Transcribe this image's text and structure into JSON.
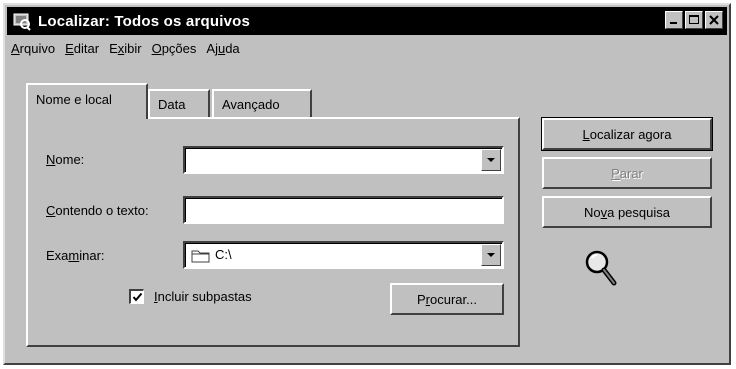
{
  "window": {
    "title": "Localizar: Todos os arquivos",
    "icon": "find-window-icon"
  },
  "menu": [
    {
      "pre": "",
      "u": "A",
      "post": "rquivo"
    },
    {
      "pre": "",
      "u": "E",
      "post": "ditar"
    },
    {
      "pre": "E",
      "u": "x",
      "post": "ibir"
    },
    {
      "pre": "",
      "u": "O",
      "post": "pções"
    },
    {
      "pre": "Aj",
      "u": "u",
      "post": "da"
    }
  ],
  "tabs": [
    {
      "label": "Nome e local",
      "active": true
    },
    {
      "label": "Data",
      "active": false
    },
    {
      "label": "Avançado",
      "active": false
    }
  ],
  "form": {
    "nome": {
      "pre": "",
      "u": "N",
      "post": "ome:",
      "value": ""
    },
    "contendo": {
      "pre": "",
      "u": "C",
      "post": "ontendo o texto:",
      "value": ""
    },
    "examinar": {
      "pre": "Exa",
      "u": "m",
      "post": "inar:",
      "value": "C:\\",
      "icon": "folder-icon"
    },
    "incluir": {
      "pre": "",
      "u": "I",
      "post": "ncluir subpastas",
      "checked": true
    },
    "procurar": {
      "pre": "P",
      "u": "r",
      "post": "ocurar..."
    }
  },
  "buttons": {
    "localizar": {
      "pre": "",
      "u": "L",
      "post": "ocalizar agora",
      "enabled": true
    },
    "parar": {
      "pre": "",
      "u": "P",
      "post": "arar",
      "enabled": false
    },
    "nova": {
      "pre": "No",
      "u": "v",
      "post": "a pesquisa",
      "enabled": true
    }
  },
  "status_icon": "magnifier-icon",
  "colors": {
    "face": "#c0c0c0",
    "titlebar": "#000000",
    "highlight": "#ffffff",
    "shadow": "#404040"
  }
}
